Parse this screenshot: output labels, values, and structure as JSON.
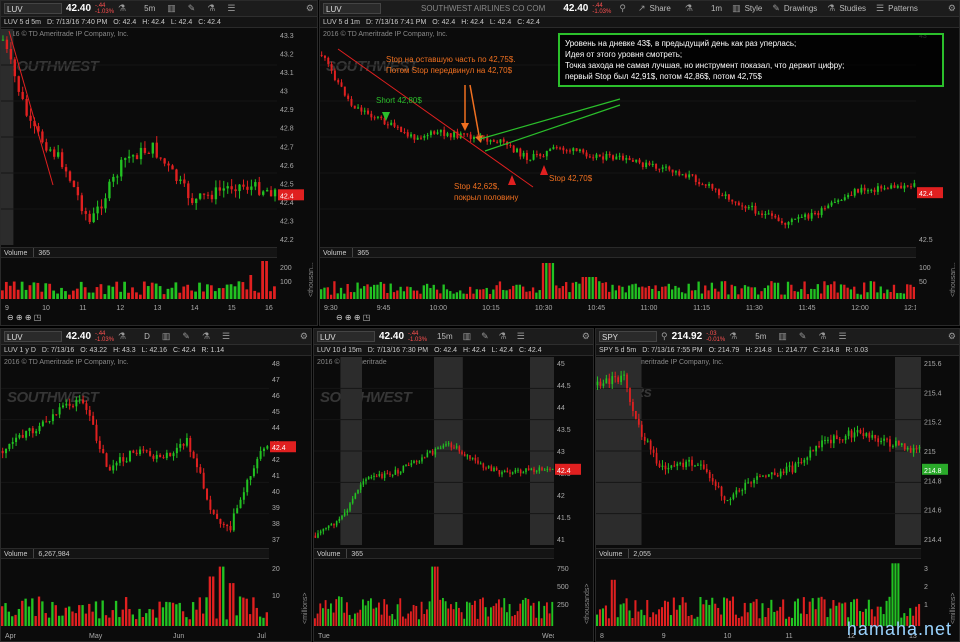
{
  "colors": {
    "up": "#22c222",
    "down": "#e02020",
    "annotation": "#f07020",
    "box": "#2bbf2b",
    "tag_red": "#e02020",
    "tag_green": "#2aaa2a"
  },
  "p1": {
    "symbol": "LUV",
    "price": "42.40",
    "chg1": "-.44",
    "chg2": "-1.03%",
    "interval": "5m",
    "period": "LUV 5 d 5m",
    "date": "D: 7/13/16 7:40 PM",
    "o": "O: 42.4",
    "h": "H: 42.4",
    "l": "L: 42.4",
    "c": "C: 42.4",
    "copyright": "2016 © TD Ameritrade IP Company, Inc.",
    "watermark": "SOUTHWEST",
    "vol_label": "Volume",
    "vol_val": "365",
    "y_ticks": [
      "43.3",
      "43.2",
      "43.1",
      "43",
      "42.9",
      "42.8",
      "42.7",
      "42.6",
      "42.5",
      "42.4",
      "42.3",
      "42.2"
    ],
    "x_ticks": [
      "9",
      "10",
      "11",
      "12",
      "13",
      "14",
      "15",
      "16"
    ],
    "vol_ticks": [
      "200",
      "100"
    ],
    "vol_unit": "<thousan...",
    "last": "42.4"
  },
  "p2": {
    "symbol": "LUV",
    "desc": "SOUTHWEST AIRLINES CO COM",
    "price": "42.40",
    "chg1": "-.44",
    "chg2": "-1.03%",
    "share": "Share",
    "interval": "1m",
    "style": "Style",
    "drawings": "Drawings",
    "studies": "Studies",
    "patterns": "Patterns",
    "period": "LUV 5 d 1m",
    "date": "D: 7/13/16 7:41 PM",
    "o": "O: 42.4",
    "h": "H: 42.4",
    "l": "L: 42.4",
    "c": "C: 42.4",
    "copyright": "2016 © TD Ameritrade IP Company, Inc.",
    "watermark": "SOUTHWEST",
    "vol_label": "Volume",
    "vol_val": "365",
    "y_ticks": [
      "43",
      "42.5"
    ],
    "x_ticks": [
      "9:30",
      "9:45",
      "10:00",
      "10:15",
      "10:30",
      "10:45",
      "11:00",
      "11:15",
      "11:30",
      "11:45",
      "12:00",
      "12:15"
    ],
    "vol_ticks": [
      "100",
      "50"
    ],
    "vol_unit": "<thousan...",
    "last": "42.4",
    "annotations": {
      "short": "Short 42,80$",
      "stop1_a": "Stop на оставшую часть по 42,75$.",
      "stop1_b": "Потом Stop передвинул на 42,70$",
      "stop_half_a": "Stop 42,62$,",
      "stop_half_b": "покрыл половину",
      "stop_270": "Stop 42,70$",
      "box_l1": "Уровень на дневке 43$, в предыдущий день как раз уперлась;",
      "box_l2": "Идея от этого уровня смотреть;",
      "box_l3": "Точка захода не самая лучшая, но инструмент показал, что держит цифру;",
      "box_l4": "первый Stop был 42,91$, потом 42,86$, потом 42,75$"
    }
  },
  "p3": {
    "symbol": "LUV",
    "price": "42.40",
    "chg1": "-.44",
    "chg2": "-1.03%",
    "interval": "D",
    "period": "LUV 1 y D",
    "date": "D: 7/13/16",
    "o": "O: 43.22",
    "h": "H: 43.3",
    "l": "L: 42.16",
    "c": "C: 42.4",
    "r": "R: 1.14",
    "copyright": "2016 © TD Ameritrade IP Company, Inc.",
    "watermark": "SOUTHWEST",
    "vol_label": "Volume",
    "vol_val": "6,267,984",
    "y_ticks": [
      "48",
      "47",
      "46",
      "45",
      "44",
      "43",
      "42",
      "41",
      "40",
      "39",
      "38",
      "37"
    ],
    "x_ticks": [
      "Apr",
      "May",
      "Jun",
      "Jul"
    ],
    "vol_ticks": [
      "20",
      "10"
    ],
    "vol_unit": "<millions>",
    "last": "42.4"
  },
  "p4": {
    "symbol": "LUV",
    "price": "42.40",
    "chg1": "-.44",
    "chg2": "-1.03%",
    "interval": "15m",
    "period": "LUV 10 d 15m",
    "date": "D: 7/13/16 7:30 PM",
    "o": "O: 42.4",
    "h": "H: 42.4",
    "l": "L: 42.4",
    "c": "C: 42.4",
    "copyright": "2016 © TD Ameritrade",
    "watermark": "SOUTHWEST",
    "vol_label": "Volume",
    "vol_val": "365",
    "y_ticks": [
      "45",
      "44.5",
      "44",
      "43.5",
      "43",
      "42.5",
      "42",
      "41.5",
      "41"
    ],
    "x_ticks": [
      "Tue",
      "Wed"
    ],
    "vol_ticks": [
      "750",
      "500",
      "250"
    ],
    "vol_unit": "<thousands>",
    "last": "42.4"
  },
  "p5": {
    "symbol": "SPY",
    "price": "214.92",
    "chg1": "-.03",
    "chg2": "-0.01%",
    "interval": "5m",
    "period": "SPY 5 d 5m",
    "date": "D: 7/13/16 7:55 PM",
    "o": "O: 214.79",
    "h": "H: 214.8",
    "l": "L: 214.77",
    "c": "C: 214.8",
    "r": "R: 0.03",
    "copyright": "2016 © TD Ameritrade IP Company, Inc.",
    "watermark": "SPDRs",
    "vol_label": "Volume",
    "vol_val": "2,055",
    "y_ticks": [
      "215.6",
      "215.4",
      "215.2",
      "215",
      "214.8",
      "214.6",
      "214.4"
    ],
    "x_ticks": [
      "8",
      "9",
      "10",
      "11",
      "12",
      "13"
    ],
    "vol_ticks": [
      "3",
      "2",
      "1"
    ],
    "vol_unit": "<millions>",
    "last": "214.8"
  },
  "brand": "hamaha.net"
}
